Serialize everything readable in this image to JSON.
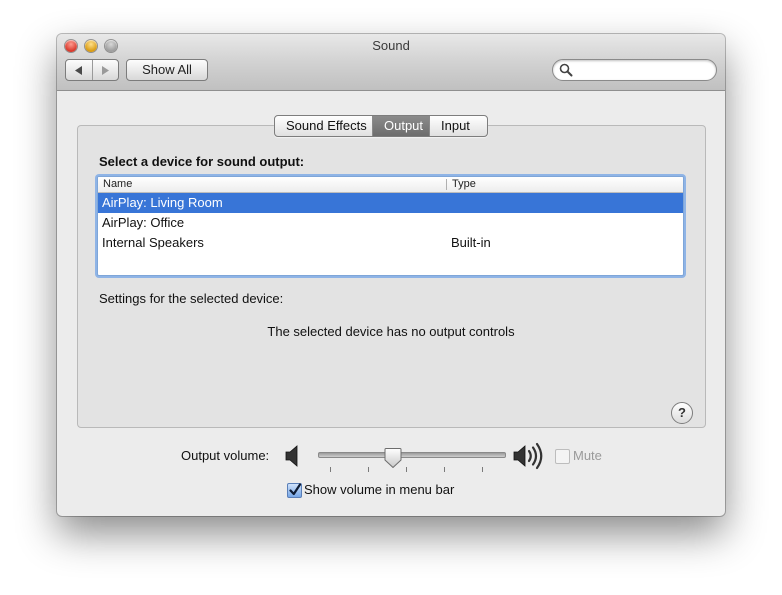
{
  "window": {
    "title": "Sound"
  },
  "toolbar": {
    "back_icon": "back-arrow-icon",
    "forward_icon": "forward-arrow-icon",
    "show_all_label": "Show All",
    "search_placeholder": "",
    "search_value": ""
  },
  "tabs": [
    {
      "label": "Sound Effects",
      "selected": false
    },
    {
      "label": "Output",
      "selected": true
    },
    {
      "label": "Input",
      "selected": false
    }
  ],
  "output": {
    "heading": "Select a device for sound output:",
    "columns": {
      "name": "Name",
      "type": "Type"
    },
    "devices": [
      {
        "name": "AirPlay: Living Room",
        "type": "",
        "selected": true
      },
      {
        "name": "AirPlay: Office",
        "type": "",
        "selected": false
      },
      {
        "name": "Internal Speakers",
        "type": "Built-in",
        "selected": false
      }
    ],
    "settings_label": "Settings for the selected device:",
    "no_controls_message": "The selected device has no output controls",
    "help_label": "?"
  },
  "volume": {
    "label": "Output volume:",
    "level_fraction": 0.4,
    "mute_label": "Mute",
    "mute_checked": false,
    "mute_enabled": false,
    "show_in_menu_bar_label": "Show volume in menu bar",
    "show_in_menu_bar_checked": true
  },
  "colors": {
    "selection": "#3875d7",
    "focus_ring": "#8fb4e6"
  }
}
